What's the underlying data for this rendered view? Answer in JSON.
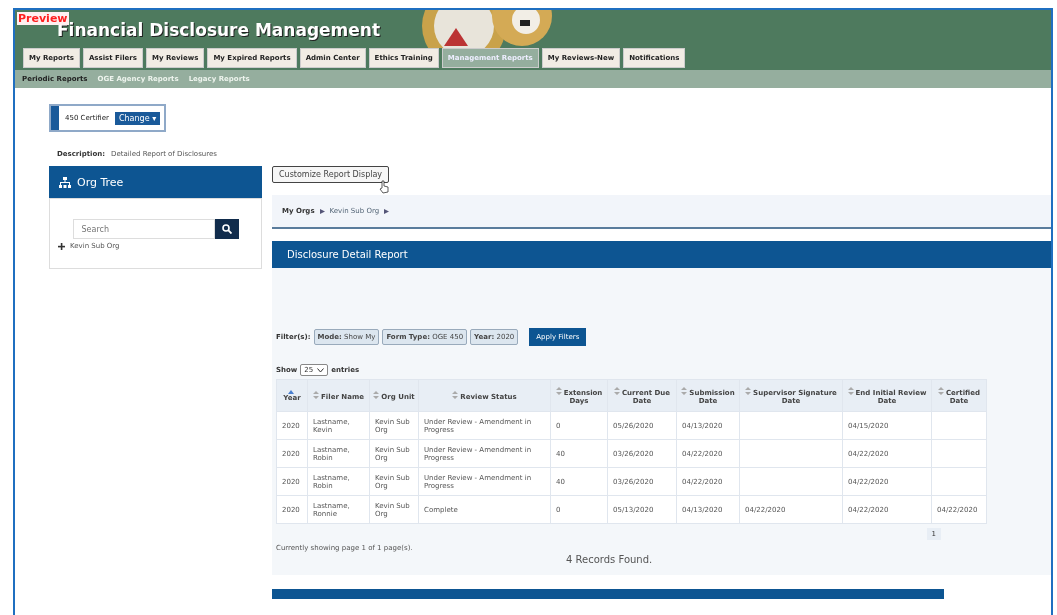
{
  "header": {
    "badge": "Preview",
    "title": "Financial Disclosure Management"
  },
  "tabs": [
    {
      "label": "My Reports",
      "selected": false
    },
    {
      "label": "Assist Filers",
      "selected": false
    },
    {
      "label": "My Reviews",
      "selected": false
    },
    {
      "label": "My Expired Reports",
      "selected": false
    },
    {
      "label": "Admin Center",
      "selected": false
    },
    {
      "label": "Ethics Training",
      "selected": false
    },
    {
      "label": "Management Reports",
      "selected": true
    },
    {
      "label": "My Reviews-New",
      "selected": false
    },
    {
      "label": "Notifications",
      "selected": false
    }
  ],
  "subtabs": [
    {
      "label": "Periodic Reports",
      "selected": true
    },
    {
      "label": "OGE Agency Reports",
      "selected": false
    },
    {
      "label": "Legacy Reports",
      "selected": false
    }
  ],
  "role": {
    "name": "450 Certifier",
    "button": "Change ▾"
  },
  "description": {
    "label": "Description:",
    "value": "Detailed Report of Disclosures"
  },
  "org_tree": {
    "title": "Org Tree",
    "search_placeholder": "Search",
    "items": [
      {
        "label": "Kevin Sub Org"
      }
    ]
  },
  "customize_button": "Customize Report Display",
  "breadcrumb": {
    "root": "My Orgs",
    "items": [
      "Kevin Sub Org"
    ]
  },
  "report": {
    "title": "Disclosure Detail Report",
    "filters_label": "Filter(s):",
    "filters": [
      {
        "name": "Mode:",
        "value": "Show My"
      },
      {
        "name": "Form Type:",
        "value": "OGE 450"
      },
      {
        "name": "Year:",
        "value": "2020"
      }
    ],
    "apply_button": "Apply Filters",
    "length": {
      "before": "Show",
      "value": "25",
      "after": "entries"
    },
    "columns": [
      {
        "label": "Year",
        "sorted": true
      },
      {
        "label": "Filer Name",
        "sorted": false
      },
      {
        "label": "Org Unit",
        "sorted": false
      },
      {
        "label": "Review Status",
        "sorted": false
      },
      {
        "label": "Extension Days",
        "sorted": false
      },
      {
        "label": "Current Due Date",
        "sorted": false
      },
      {
        "label": "Submission Date",
        "sorted": false
      },
      {
        "label": "Supervisor Signature Date",
        "sorted": false
      },
      {
        "label": "End Initial Review Date",
        "sorted": false
      },
      {
        "label": "Certified Date",
        "sorted": false
      }
    ],
    "rows": [
      [
        "2020",
        "Lastname, Kevin",
        "Kevin Sub Org",
        "Under Review - Amendment in Progress",
        "0",
        "05/26/2020",
        "04/13/2020",
        "",
        "04/15/2020",
        ""
      ],
      [
        "2020",
        "Lastname, Robin",
        "Kevin Sub Org",
        "Under Review - Amendment in Progress",
        "40",
        "03/26/2020",
        "04/22/2020",
        "",
        "04/22/2020",
        ""
      ],
      [
        "2020",
        "Lastname, Robin",
        "Kevin Sub Org",
        "Under Review - Amendment in Progress",
        "40",
        "03/26/2020",
        "04/22/2020",
        "",
        "04/22/2020",
        ""
      ],
      [
        "2020",
        "Lastname, Ronnie",
        "Kevin Sub Org",
        "Complete",
        "0",
        "05/13/2020",
        "04/13/2020",
        "04/22/2020",
        "04/22/2020",
        "04/22/2020"
      ]
    ],
    "pages": [
      {
        "label": "1",
        "selected": true
      }
    ],
    "page_info": "Currently showing page 1 of 1 page(s).",
    "records": "4 Records Found."
  }
}
